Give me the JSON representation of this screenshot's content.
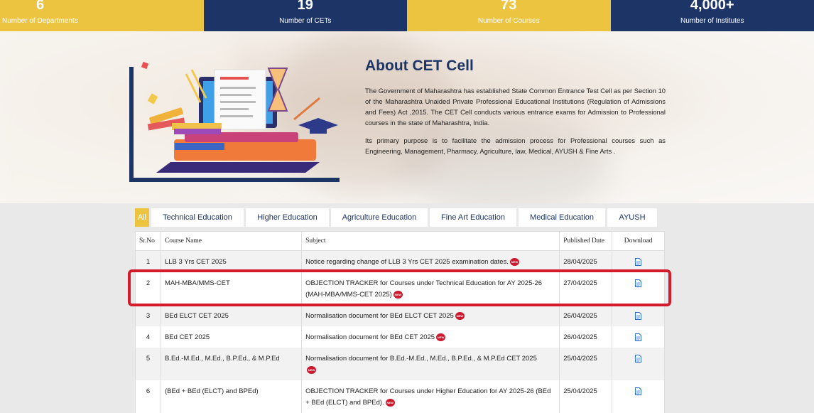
{
  "stats": [
    {
      "value": "6",
      "label": "Number of Departments"
    },
    {
      "value": "19",
      "label": "Number of CETs"
    },
    {
      "value": "73",
      "label": "Number of Courses"
    },
    {
      "value": "4,000+",
      "label": "Number of Institutes"
    }
  ],
  "about": {
    "title": "About CET Cell",
    "p1": "The Government of Maharashtra has established State Common Entrance Test Cell as per Section 10 of the Maharashtra Unaided Private Professional Educational Institutions (Regulation of Admissions and Fees) Act ,2015. The CET Cell conducts various entrance exams for Admission to Professional courses in the state of Maharashtra, India.",
    "p2": "Its primary purpose is to facilitate the admission process for Professional courses such as Engineering, Management, Pharmacy, Agriculture, law, Medical, AYUSH & Fine Arts ."
  },
  "tabs": [
    "All",
    "Technical Education",
    "Higher Education",
    "Agriculture Education",
    "Fine Art Education",
    "Medical Education",
    "AYUSH"
  ],
  "table": {
    "headers": [
      "Sr.No",
      "Course Name",
      "Subject",
      "Published Date",
      "Download"
    ],
    "new_badge": "NEW",
    "rows": [
      {
        "no": "1",
        "course": "LLB 3 Yrs CET 2025",
        "subject": "Notice regarding change of LLB 3 Yrs CET 2025 examination dates.",
        "date": "28/04/2025"
      },
      {
        "no": "2",
        "course": "MAH-MBA/MMS-CET",
        "subject": "OBJECTION TRACKER for Courses under Technical Education for AY 2025-26 (MAH-MBA/MMS-CET 2025)",
        "date": "27/04/2025"
      },
      {
        "no": "3",
        "course": "BEd ELCT CET 2025",
        "subject": "Normalisation document for BEd ELCT CET 2025",
        "date": "26/04/2025"
      },
      {
        "no": "4",
        "course": "BEd CET 2025",
        "subject": "Normalisation document for BEd CET 2025",
        "date": "26/04/2025"
      },
      {
        "no": "5",
        "course": "B.Ed.-M.Ed., M.Ed., B.P.Ed., & M.P.Ed",
        "subject": "Normalisation document for B.Ed.-M.Ed., M.Ed., B.P.Ed., & M.P.Ed CET 2025",
        "date": "25/04/2025"
      },
      {
        "no": "6",
        "course": "(BEd + BEd (ELCT) and BPEd)",
        "subject": "OBJECTION TRACKER for Courses under Higher Education for AY 2025-26 (BEd + BEd (ELCT) and BPEd).",
        "date": "25/04/2025"
      }
    ]
  }
}
